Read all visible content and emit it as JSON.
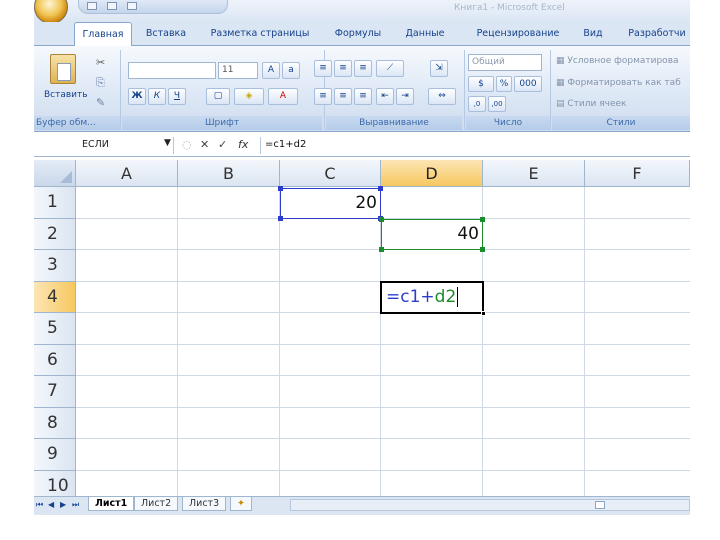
{
  "window": {
    "title": "Книга1 - Microsoft Excel"
  },
  "ribbon": {
    "tabs": [
      "Главная",
      "Вставка",
      "Разметка страницы",
      "Формулы",
      "Данные",
      "Рецензирование",
      "Вид",
      "Разработчи"
    ],
    "active_tab": "Главная",
    "clipboard": {
      "paste_label": "Вставить",
      "group": "Буфер обм..."
    },
    "font": {
      "size": "11",
      "group": "Шрифт"
    },
    "alignment": {
      "group": "Выравнивание"
    },
    "number": {
      "format": "Общий",
      "percent": "%",
      "thousands": "000",
      "group": "Число"
    },
    "styles": {
      "conditional": "Условное форматирова",
      "table": "Форматировать как таб",
      "cell": "Стили ячеек",
      "group": "Стили"
    }
  },
  "formula_bar": {
    "name_box": "ЕСЛИ",
    "formula": "=c1+d2"
  },
  "grid": {
    "columns": [
      "A",
      "B",
      "C",
      "D",
      "E",
      "F"
    ],
    "rows": [
      "1",
      "2",
      "3",
      "4",
      "5",
      "6",
      "7",
      "8",
      "9",
      "10"
    ],
    "selected_column": "D",
    "selected_row": "4",
    "cells": {
      "C1": "20",
      "D2": "40",
      "D4": {
        "text_a": "=c1+",
        "text_b": "d2"
      }
    },
    "colors": {
      "ref_c1": "#2d3ccc",
      "ref_d2": "#1b8c2a",
      "header_sel": "#f7c75f"
    }
  },
  "sheets": {
    "tabs": [
      "Лист1",
      "Лист2",
      "Лист3"
    ],
    "active": "Лист1"
  }
}
